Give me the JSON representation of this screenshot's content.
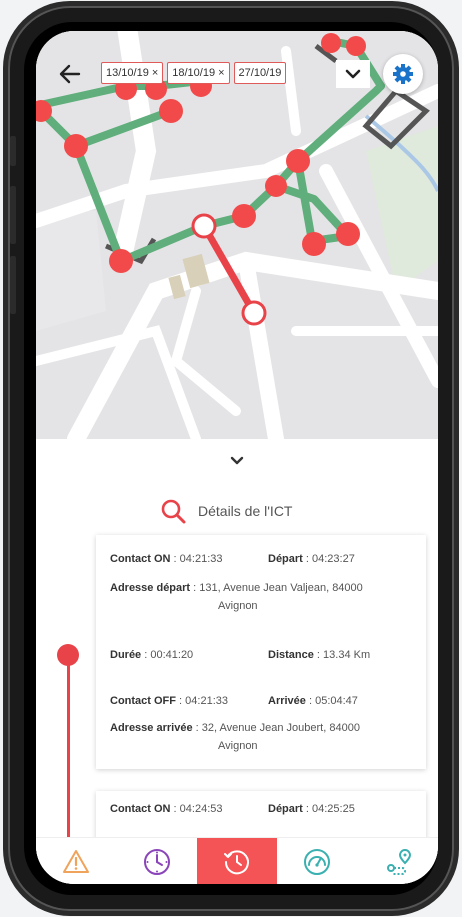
{
  "colors": {
    "accent": "#e9434a",
    "route_green": "#5fae7b",
    "settings_blue": "#1a73c8",
    "active_tab": "#f45455"
  },
  "header": {
    "back_icon": "arrow-left-icon",
    "date_chips": [
      "13/10/19",
      "18/10/19",
      "27/10/19"
    ],
    "dropdown_icon": "chevron-down-icon",
    "settings_icon": "gear-icon"
  },
  "panel": {
    "collapse_icon": "chevron-down-icon",
    "search_label": "Détails de l'ICT"
  },
  "trips": [
    {
      "contact_on_label": "Contact ON",
      "contact_on": "04:21:33",
      "depart_label": "Départ",
      "depart": "04:23:27",
      "adresse_depart_label": "Adresse départ",
      "adresse_depart_1": "131, Avenue Jean Valjean, 84000",
      "adresse_depart_2": "Avignon",
      "duree_label": "Durée",
      "duree": "00:41:20",
      "distance_label": "Distance",
      "distance": "13.34 Km",
      "contact_off_label": "Contact OFF",
      "contact_off": "04:21:33",
      "arrivee_label": "Arrivée",
      "arrivee": "05:04:47",
      "adresse_arrivee_label": "Adresse arrivée",
      "adresse_arrivee_1": "32, Avenue Jean Joubert, 84000",
      "adresse_arrivee_2": "Avignon"
    },
    {
      "contact_on_label": "Contact ON",
      "contact_on": "04:24:53",
      "depart_label": "Départ",
      "depart": "04:25:25"
    }
  ],
  "tabbar": [
    {
      "icon": "warning-icon",
      "color": "#f0a35a",
      "active": false
    },
    {
      "icon": "clock-icon",
      "color": "#8a45b8",
      "active": false
    },
    {
      "icon": "history-icon",
      "color": "#ffffff",
      "active": true
    },
    {
      "icon": "speedometer-icon",
      "color": "#3bb0b0",
      "active": false
    },
    {
      "icon": "route-icon",
      "color": "#3bb0b0",
      "active": false
    }
  ]
}
